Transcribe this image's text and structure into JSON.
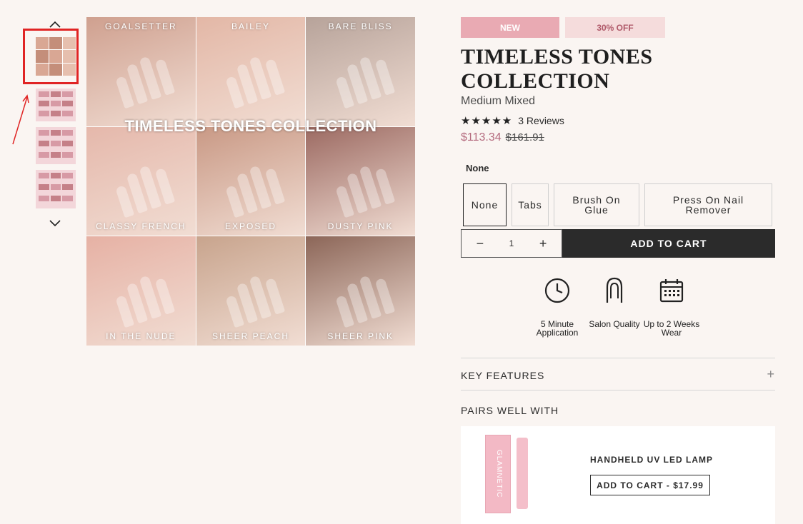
{
  "thumbnails": {
    "up_icon": "chevron-up-icon",
    "down_icon": "chevron-down-icon"
  },
  "main_image": {
    "overlay_title": "TIMELESS TONES COLLECTION",
    "tiles": [
      {
        "label": "GOALSETTER",
        "color": "#cfa08f"
      },
      {
        "label": "BAILEY",
        "color": "#e3b7a6"
      },
      {
        "label": "BARE BLISS",
        "color": "#b7a39a"
      },
      {
        "label": "CLASSY FRENCH",
        "color": "#e5b8ab"
      },
      {
        "label": "EXPOSED",
        "color": "#c99985"
      },
      {
        "label": "DUSTY PINK",
        "color": "#9c6a62"
      },
      {
        "label": "IN THE NUDE",
        "color": "#e6b1a4"
      },
      {
        "label": "SHEER PEACH",
        "color": "#c8a48d"
      },
      {
        "label": "SHEER PINK",
        "color": "#8c6658"
      }
    ]
  },
  "product": {
    "badge_new": "NEW",
    "badge_discount": "30% OFF",
    "title": "TIMELESS TONES COLLECTION",
    "variant": "Medium Mixed",
    "stars": "★★★★★",
    "reviews": "3 Reviews",
    "price": "$113.34",
    "compare_price": "$161.91"
  },
  "options": {
    "selected_label": "None",
    "items": [
      "None",
      "Tabs",
      "Brush On Glue",
      "Press On Nail Remover"
    ]
  },
  "cart": {
    "minus": "−",
    "quantity": "1",
    "plus": "+",
    "add_label": "ADD TO CART"
  },
  "features": [
    {
      "icon": "clock-icon",
      "label": "5 Minute Application"
    },
    {
      "icon": "nail-icon",
      "label": "Salon Quality"
    },
    {
      "icon": "calendar-icon",
      "label": "Up to 2 Weeks Wear"
    }
  ],
  "sections": {
    "key_features": "KEY FEATURES",
    "expand_icon": "+",
    "pairs_well": "PAIRS WELL WITH"
  },
  "pair_product": {
    "name": "HANDHELD UV LED LAMP",
    "button": "ADD TO CART - $17.99",
    "brand_text": "GLAMNETIC"
  },
  "colors": {
    "accent_pink": "#e9aab3",
    "price": "#b46a7e",
    "dark_button": "#2b2b2b",
    "annotation_red": "#e02424"
  }
}
